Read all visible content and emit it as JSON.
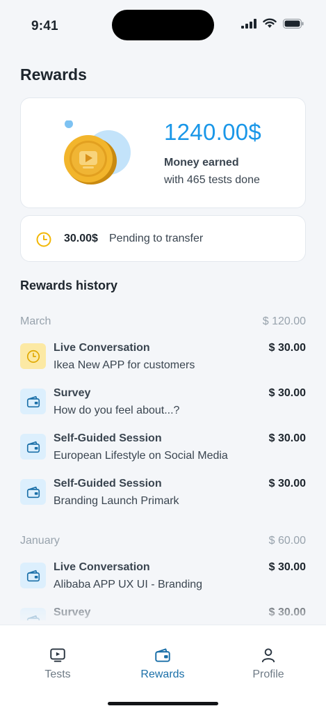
{
  "status_bar": {
    "time": "9:41"
  },
  "page": {
    "title": "Rewards"
  },
  "earnings": {
    "amount": "1240.00$",
    "label": "Money earned",
    "sub_label": "with 465 tests done"
  },
  "pending": {
    "amount": "30.00$",
    "label": "Pending to transfer",
    "icon": "clock-icon"
  },
  "history": {
    "title": "Rewards history",
    "months": [
      {
        "name": "March",
        "total": "$ 120.00",
        "entries": [
          {
            "title": "Live Conversation",
            "subtitle": "Ikea New APP for customers",
            "amount": "$ 30.00",
            "icon": "clock-icon",
            "status": "pending"
          },
          {
            "title": "Survey",
            "subtitle": "How do you feel about...?",
            "amount": "$ 30.00",
            "icon": "wallet-icon",
            "status": "paid"
          },
          {
            "title": "Self-Guided Session",
            "subtitle": "European Lifestyle on Social Media",
            "amount": "$ 30.00",
            "icon": "wallet-icon",
            "status": "paid"
          },
          {
            "title": "Self-Guided Session",
            "subtitle": "Branding Launch Primark",
            "amount": "$ 30.00",
            "icon": "wallet-icon",
            "status": "paid"
          }
        ]
      },
      {
        "name": "January",
        "total": "$ 60.00",
        "entries": [
          {
            "title": "Live Conversation",
            "subtitle": "Alibaba APP UX UI - Branding",
            "amount": "$ 30.00",
            "icon": "wallet-icon",
            "status": "paid"
          },
          {
            "title": "Survey",
            "subtitle": "",
            "amount": "$ 30.00",
            "icon": "wallet-icon",
            "status": "paid"
          }
        ]
      }
    ]
  },
  "tabs": [
    {
      "label": "Tests",
      "icon": "play-icon",
      "active": false
    },
    {
      "label": "Rewards",
      "icon": "wallet-icon",
      "active": true
    },
    {
      "label": "Profile",
      "icon": "person-icon",
      "active": false
    }
  ],
  "colors": {
    "accent": "#1a97e8",
    "tab_active": "#1a6fa8",
    "pending": "#f2b705",
    "background": "#f4f6f9"
  }
}
